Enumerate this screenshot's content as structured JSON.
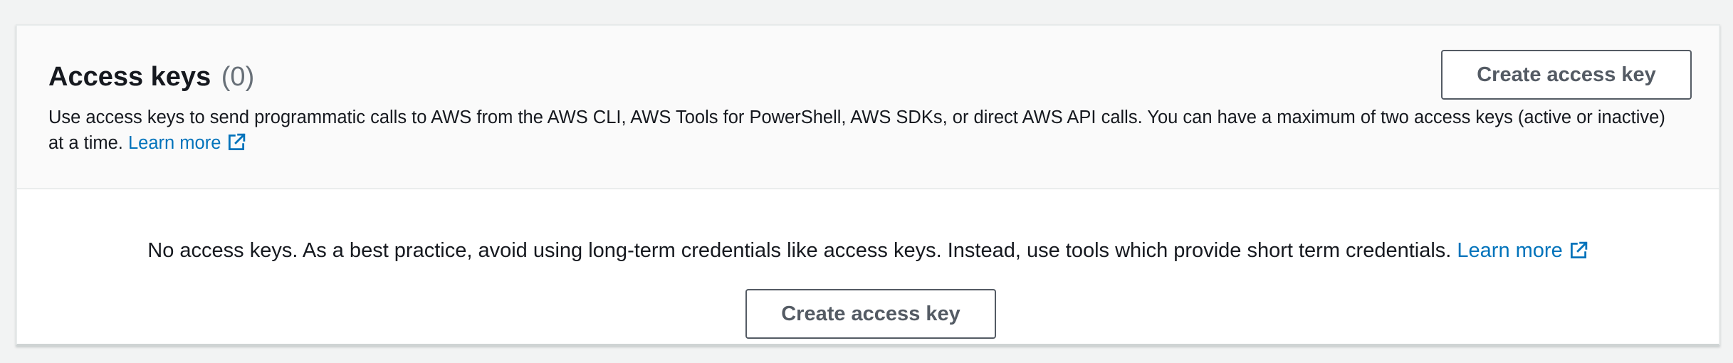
{
  "panel": {
    "title": "Access keys",
    "count": "(0)",
    "description": "Use access keys to send programmatic calls to AWS from the AWS CLI, AWS Tools for PowerShell, AWS SDKs, or direct AWS API calls. You can have a maximum of two access keys (active or inactive) at a time.",
    "learn_more": "Learn more",
    "create_button": "Create access key"
  },
  "empty_state": {
    "message": "No access keys. As a best practice, avoid using long-term credentials like access keys. Instead, use tools which provide short term credentials.",
    "learn_more": "Learn more",
    "create_button": "Create access key"
  },
  "icons": {
    "external_link": "external-link-icon"
  },
  "colors": {
    "link": "#0073bb",
    "button_border": "#545b64",
    "text": "#16191f",
    "muted": "#687078"
  }
}
